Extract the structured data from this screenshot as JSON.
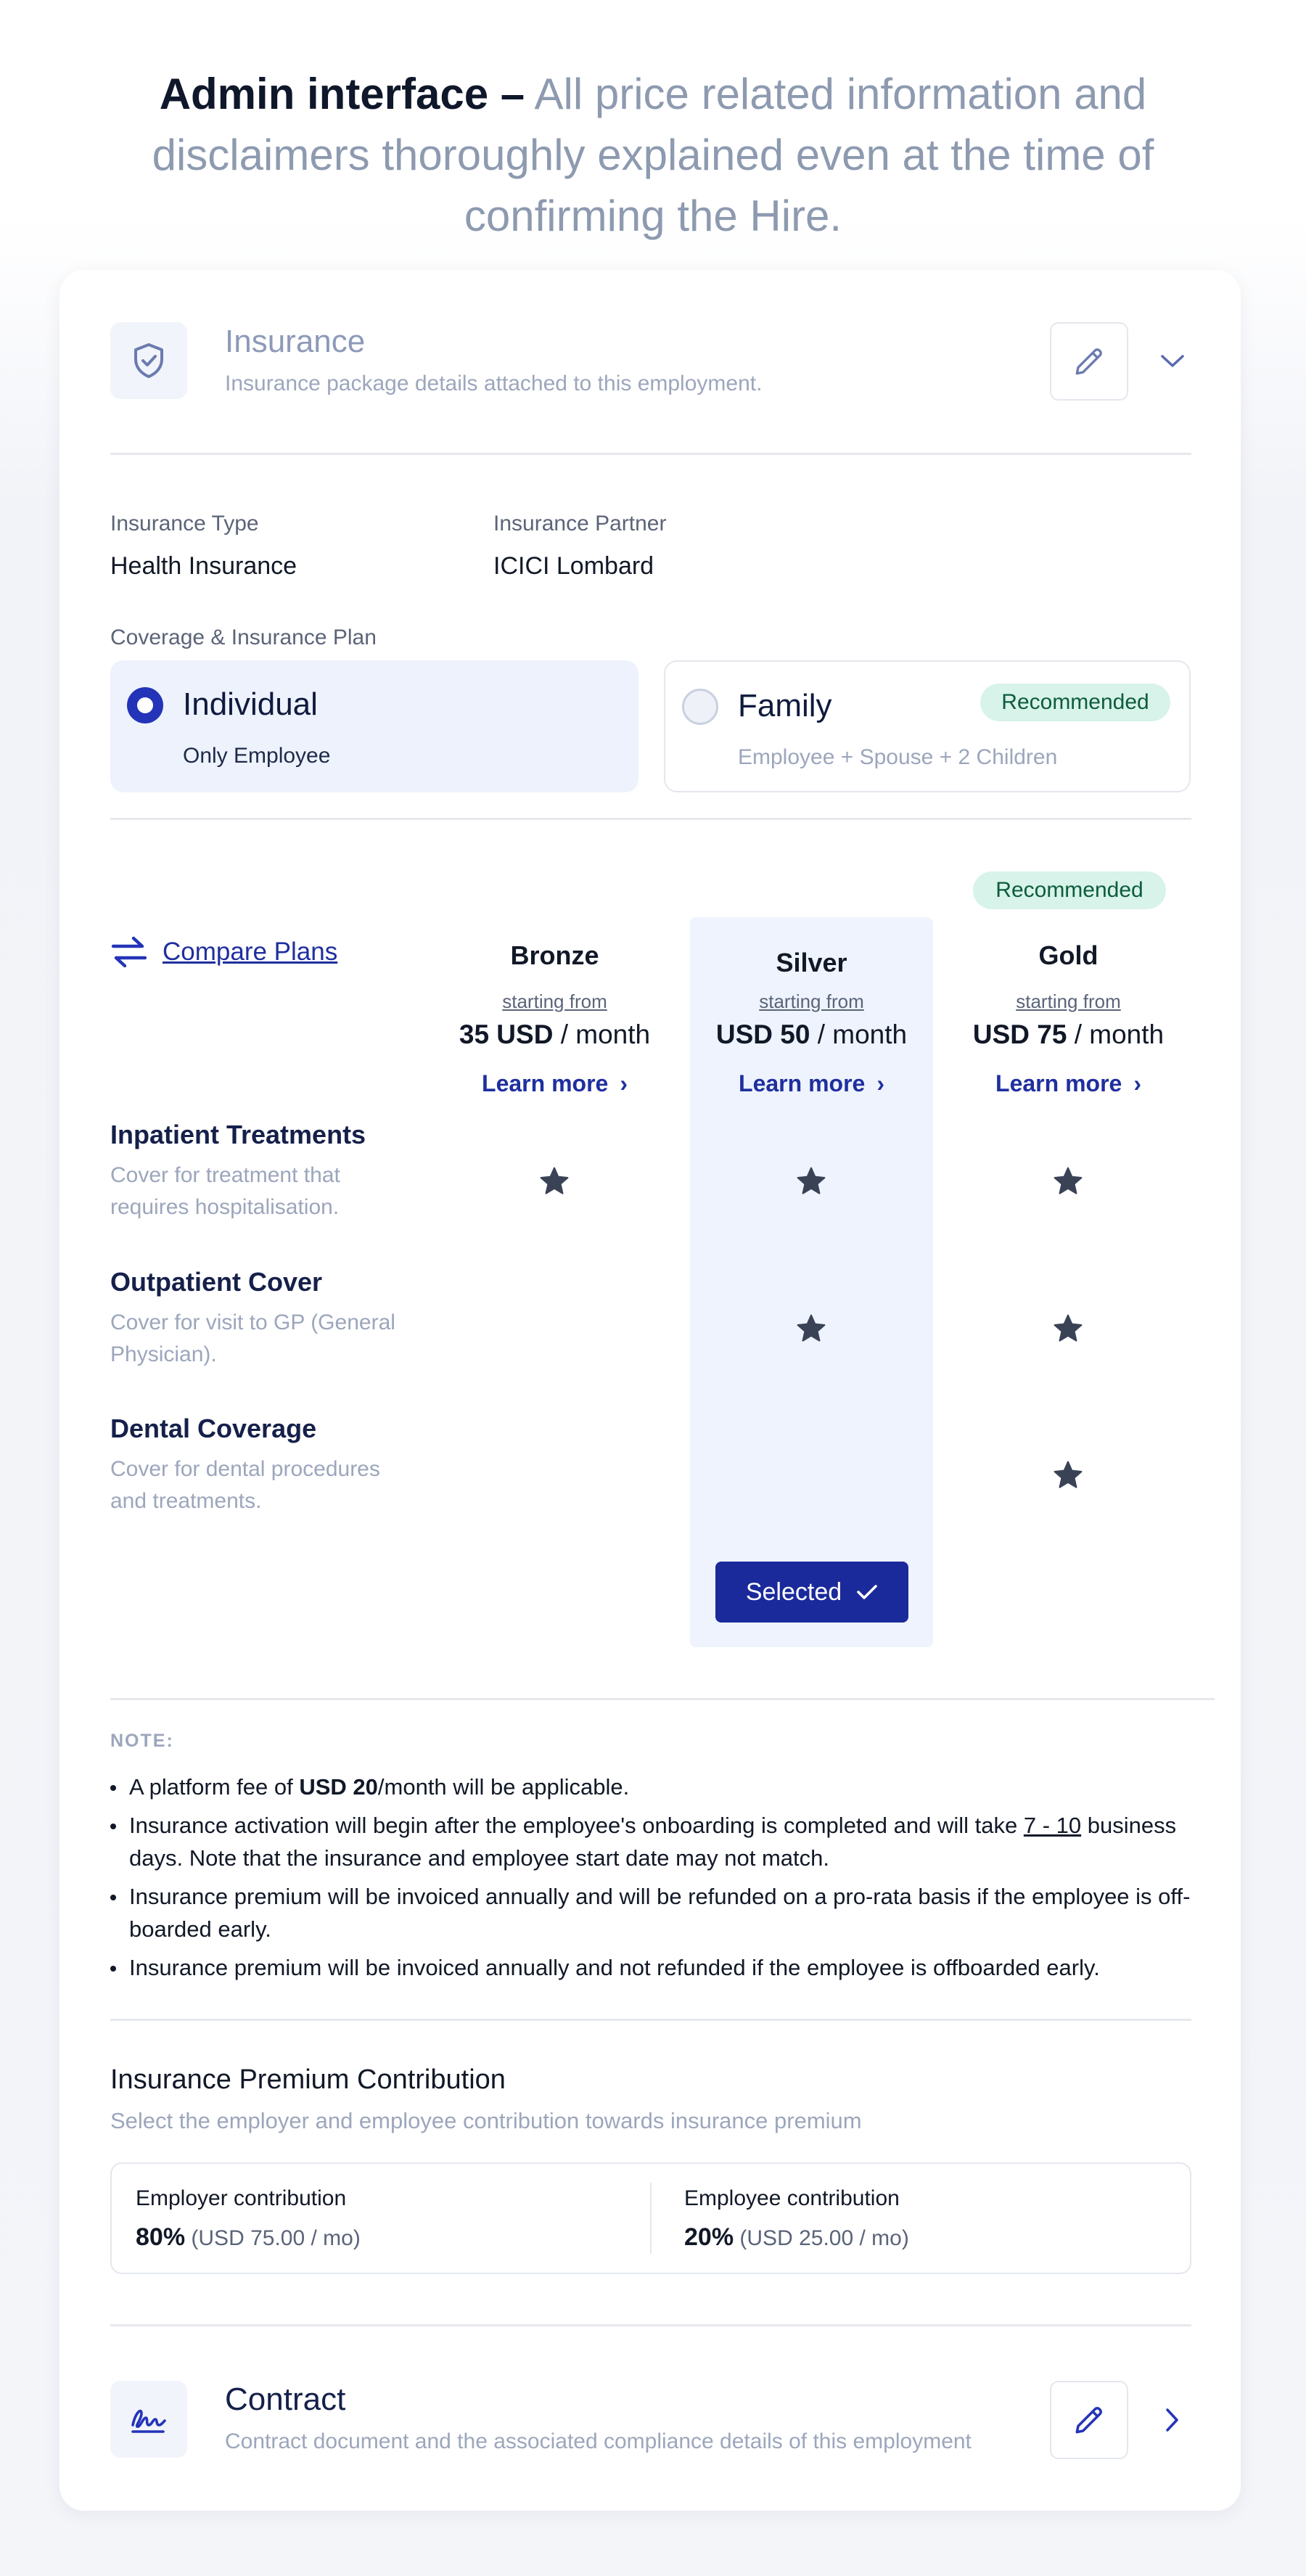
{
  "headline": {
    "bold": "Admin interface –",
    "rest": "All price related information and disclaimers thoroughly explained even at the time of confirming the Hire."
  },
  "insurance": {
    "icon": "shield-check-icon",
    "title": "Insurance",
    "subtitle": "Insurance package details attached to this employment.",
    "type_label": "Insurance Type",
    "type_value": "Health Insurance",
    "partner_label": "Insurance Partner",
    "partner_value": "ICICI Lombard",
    "coverage_label": "Coverage & Insurance Plan",
    "options": [
      {
        "title": "Individual",
        "subtitle": "Only Employee",
        "selected": true
      },
      {
        "title": "Family",
        "subtitle": "Employee + Spouse + 2 Children",
        "selected": false,
        "badge": "Recommended"
      }
    ]
  },
  "compare": {
    "link_label": "Compare Plans",
    "recommended_badge": "Recommended",
    "plans": [
      {
        "name": "Bronze",
        "starting": "starting from",
        "price": "35 USD",
        "period": " / month",
        "learn": "Learn more"
      },
      {
        "name": "Silver",
        "starting": "starting from",
        "price": "USD 50",
        "period": " / month",
        "learn": "Learn more"
      },
      {
        "name": "Gold",
        "starting": "starting from",
        "price": "USD 75",
        "period": " / month",
        "learn": "Learn more"
      }
    ],
    "features": [
      {
        "title": "Inpatient Treatments",
        "description": "Cover for treatment that requires hospitalisation.",
        "included": [
          true,
          true,
          true
        ]
      },
      {
        "title": "Outpatient Cover",
        "description": "Cover for visit to GP (General Physician).",
        "included": [
          false,
          true,
          true
        ]
      },
      {
        "title": "Dental Coverage",
        "description": "Cover for dental procedures and treatments.",
        "included": [
          false,
          false,
          true
        ]
      }
    ],
    "selected_label": "Selected"
  },
  "note": {
    "heading": "NOTE:",
    "b1_pre": "A platform fee of ",
    "b1_bold": "USD 20",
    "b1_post": "/month will be applicable.",
    "b2_pre": "Insurance activation will begin after the employee's onboarding is completed and will take ",
    "b2_ul": "7 - 10",
    "b2_post": " business days. Note that the insurance and employee start date may not match.",
    "b3": "Insurance premium will be invoiced annually and will be refunded on a pro-rata basis if the employee is off-boarded early.",
    "b4": "Insurance premium will be invoiced annually and not refunded if the employee is offboarded early."
  },
  "contribution": {
    "title": "Insurance Premium Contribution",
    "subtitle": "Select the employer and employee contribution towards insurance premium",
    "employer_label": "Employer contribution",
    "employer_pct": "80%",
    "employer_amt": "(USD 75.00 / mo)",
    "employee_label": "Employee contribution",
    "employee_pct": "20%",
    "employee_amt": "(USD 25.00 / mo)"
  },
  "contract": {
    "icon": "signature-icon",
    "title": "Contract",
    "subtitle": "Contract document and the associated compliance details of this employment"
  },
  "colors": {
    "accent": "#1a2a9b",
    "selected_bg": "#edf2fc",
    "badge_bg": "#d8f3e9",
    "badge_text": "#0d5c3d",
    "muted": "#9ca6bc"
  }
}
